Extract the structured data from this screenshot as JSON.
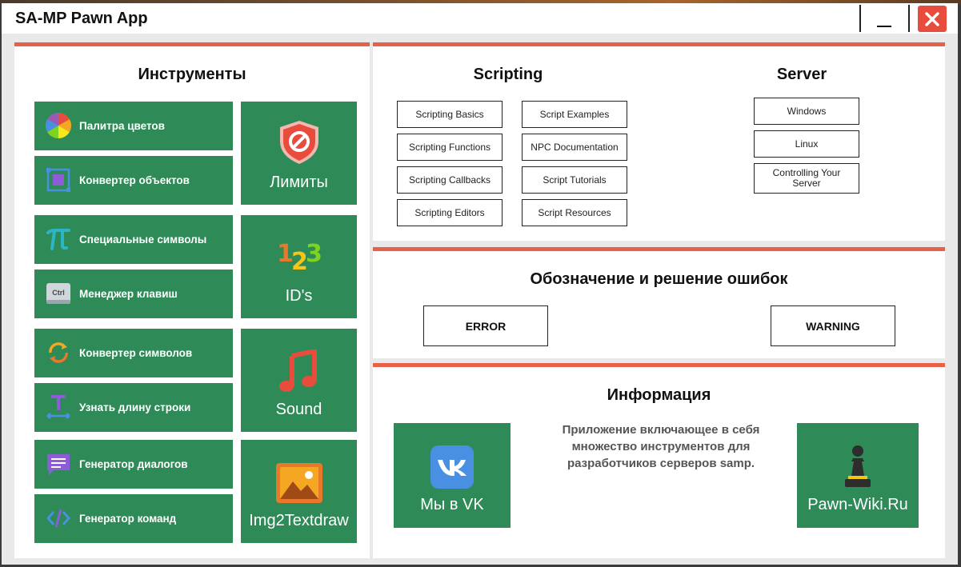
{
  "window": {
    "title": "SA-MP Pawn App"
  },
  "tools": {
    "title": "Инструменты",
    "small_tiles": [
      {
        "label": "Палитра цветов",
        "icon": "color-wheel-icon"
      },
      {
        "label": "Конвертер объектов",
        "icon": "object-converter-icon"
      },
      {
        "label": "Специальные символы",
        "icon": "pi-icon"
      },
      {
        "label": "Менеджер клавиш",
        "icon": "ctrl-key-icon"
      },
      {
        "label": "Конвертер символов",
        "icon": "refresh-icon"
      },
      {
        "label": "Узнать длину строки",
        "icon": "text-length-icon"
      },
      {
        "label": "Генератор диалогов",
        "icon": "dialog-icon"
      },
      {
        "label": "Генератор команд",
        "icon": "code-icon"
      }
    ],
    "big_tiles": [
      {
        "label": "Лимиты",
        "icon": "shield-block-icon"
      },
      {
        "label": "ID's",
        "icon": "numbers-123-icon"
      },
      {
        "label": "Sound",
        "icon": "music-note-icon"
      },
      {
        "label": "Img2Textdraw",
        "icon": "image-icon"
      }
    ]
  },
  "scripting": {
    "title": "Scripting",
    "buttons": [
      "Scripting Basics",
      "Script Examples",
      "Scripting Functions",
      "NPC Documentation",
      "Scripting Callbacks",
      "Script Tutorials",
      "Scripting Editors",
      "Script Resources"
    ]
  },
  "server": {
    "title": "Server",
    "buttons": [
      "Windows",
      "Linux",
      "Controlling Your Server"
    ]
  },
  "errors": {
    "title": "Обозначение и решение ошибок",
    "error_label": "ERROR",
    "warning_label": "WARNING"
  },
  "info": {
    "title": "Информация",
    "description_lines": [
      "Приложение включающее в себя",
      "множество инструментов для",
      "разработчиков серверов samp."
    ],
    "vk_label": "Мы в VK",
    "wiki_label": "Pawn-Wiki.Ru"
  },
  "colors": {
    "accent": "#e7604a",
    "tile_green": "#2e8b57",
    "close_red": "#e84c3d"
  }
}
